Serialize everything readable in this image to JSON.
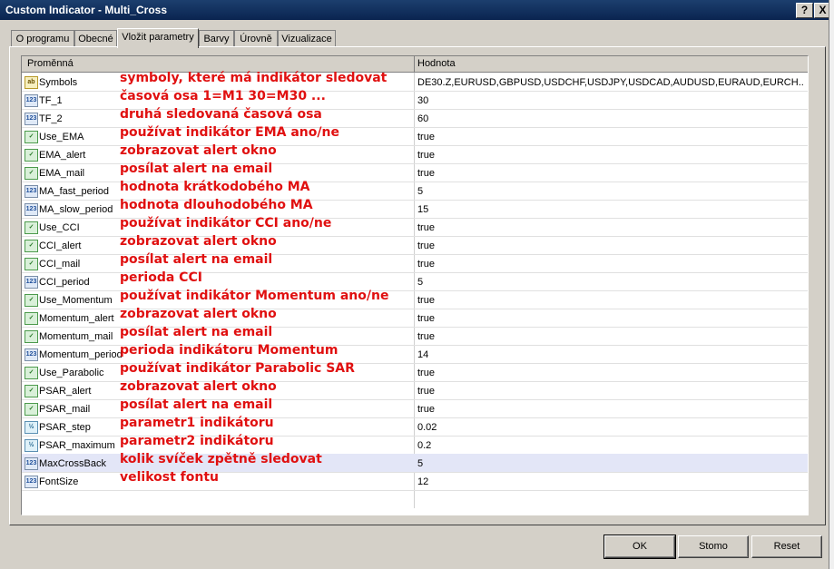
{
  "window": {
    "title": "Custom Indicator - Multi_Cross",
    "help": "?",
    "close": "X"
  },
  "tabs": [
    "O programu",
    "Obecné",
    "Vložit parametry",
    "Barvy",
    "Úrovně",
    "Vizualizace"
  ],
  "active_tab": 2,
  "grid": {
    "col_name": "Proměnná",
    "col_value": "Hodnota",
    "rows": [
      {
        "type": "str",
        "icon": "ab",
        "name": "Symbols",
        "note": "symboly, které má indikátor sledovat",
        "value": "DE30.Z,EURUSD,GBPUSD,USDCHF,USDJPY,USDCAD,AUDUSD,EURAUD,EURCH..."
      },
      {
        "type": "int",
        "icon": "123",
        "name": "TF_1",
        "note": "časová osa 1=M1 30=M30 ...",
        "value": "30"
      },
      {
        "type": "int",
        "icon": "123",
        "name": "TF_2",
        "note": "druhá sledovaná časová osa",
        "value": "60"
      },
      {
        "type": "bool",
        "icon": "✓",
        "name": "Use_EMA",
        "note": "používat indikátor EMA ano/ne",
        "value": "true"
      },
      {
        "type": "bool",
        "icon": "✓",
        "name": "EMA_alert",
        "note": "zobrazovat alert okno",
        "value": "true"
      },
      {
        "type": "bool",
        "icon": "✓",
        "name": "EMA_mail",
        "note": "posílat alert na email",
        "value": "true"
      },
      {
        "type": "int",
        "icon": "123",
        "name": "MA_fast_period",
        "note": "hodnota krátkodobého MA",
        "value": "5"
      },
      {
        "type": "int",
        "icon": "123",
        "name": "MA_slow_period",
        "note": "hodnota dlouhodobého MA",
        "value": "15"
      },
      {
        "type": "bool",
        "icon": "✓",
        "name": "Use_CCI",
        "note": "používat indikátor CCI ano/ne",
        "value": "true"
      },
      {
        "type": "bool",
        "icon": "✓",
        "name": "CCI_alert",
        "note": "zobrazovat alert okno",
        "value": "true"
      },
      {
        "type": "bool",
        "icon": "✓",
        "name": "CCI_mail",
        "note": "posílat alert na email",
        "value": "true"
      },
      {
        "type": "int",
        "icon": "123",
        "name": "CCI_period",
        "note": "perioda CCI",
        "value": "5"
      },
      {
        "type": "bool",
        "icon": "✓",
        "name": "Use_Momentum",
        "note": "používat indikátor Momentum ano/ne",
        "value": "true"
      },
      {
        "type": "bool",
        "icon": "✓",
        "name": "Momentum_alert",
        "note": "zobrazovat alert okno",
        "value": "true"
      },
      {
        "type": "bool",
        "icon": "✓",
        "name": "Momentum_mail",
        "note": "posílat alert na email",
        "value": "true"
      },
      {
        "type": "int",
        "icon": "123",
        "name": "Momentum_period",
        "note": "perioda indikátoru Momentum",
        "value": "14"
      },
      {
        "type": "bool",
        "icon": "✓",
        "name": "Use_Parabolic",
        "note": "používat indikátor Parabolic SAR",
        "value": "true"
      },
      {
        "type": "bool",
        "icon": "✓",
        "name": "PSAR_alert",
        "note": "zobrazovat alert okno",
        "value": "true"
      },
      {
        "type": "bool",
        "icon": "✓",
        "name": "PSAR_mail",
        "note": "posílat alert na email",
        "value": "true"
      },
      {
        "type": "dbl",
        "icon": "½",
        "name": "PSAR_step",
        "note": "parametr1 indikátoru",
        "value": "0.02"
      },
      {
        "type": "dbl",
        "icon": "½",
        "name": "PSAR_maximum",
        "note": "parametr2 indikátoru",
        "value": "0.2"
      },
      {
        "type": "int",
        "icon": "123",
        "name": "MaxCrossBack",
        "note": "kolik svíček zpětně sledovat",
        "value": "5"
      },
      {
        "type": "int",
        "icon": "123",
        "name": "FontSize",
        "note": "velikost fontu",
        "value": "12"
      }
    ],
    "selected_row": 21
  },
  "buttons": {
    "ok": "OK",
    "reset_default": "Stomo",
    "reset": "Reset"
  }
}
